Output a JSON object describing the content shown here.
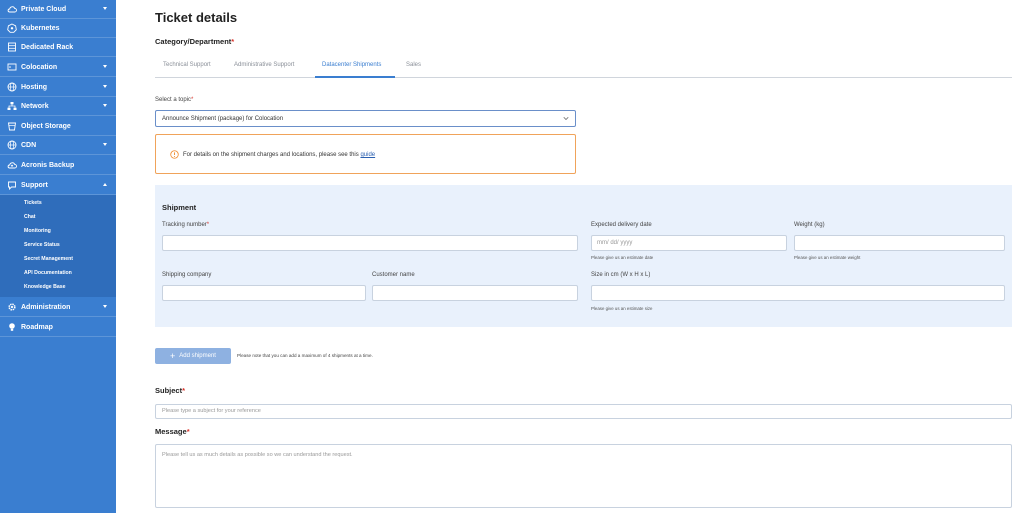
{
  "sidebar": {
    "items": [
      {
        "label": "Private Cloud",
        "icon": "cloud-icon",
        "chevron": "down"
      },
      {
        "label": "Kubernetes",
        "icon": "kubernetes-icon",
        "chevron": ""
      },
      {
        "label": "Dedicated Rack",
        "icon": "server-icon",
        "chevron": ""
      },
      {
        "label": "Colocation",
        "icon": "rack-icon",
        "chevron": "down"
      },
      {
        "label": "Hosting",
        "icon": "globe-icon",
        "chevron": "down"
      },
      {
        "label": "Network",
        "icon": "network-icon",
        "chevron": "down"
      },
      {
        "label": "Object Storage",
        "icon": "bucket-icon",
        "chevron": ""
      },
      {
        "label": "CDN",
        "icon": "globe-icon",
        "chevron": "down"
      },
      {
        "label": "Acronis Backup",
        "icon": "cloud-backup-icon",
        "chevron": ""
      },
      {
        "label": "Support",
        "icon": "support-icon",
        "chevron": "up"
      },
      {
        "label": "Administration",
        "icon": "gear-icon",
        "chevron": "down"
      },
      {
        "label": "Roadmap",
        "icon": "lightbulb-icon",
        "chevron": ""
      }
    ],
    "support_sub": [
      "Tickets",
      "Chat",
      "Monitoring",
      "Service Status",
      "Secret Management",
      "API Documentation",
      "Knowledge Base"
    ]
  },
  "page": {
    "title": "Ticket details",
    "category_label": "Category/Department",
    "tabs": [
      "Technical Support",
      "Administrative Support",
      "Datacenter Shipments",
      "Sales"
    ],
    "active_tab": "Datacenter Shipments",
    "topic_label": "Select a topic",
    "topic_value": "Announce Shipment (package) for Colocation",
    "notice_text": "For details on the shipment charges and locations, please see this ",
    "notice_link": "guide"
  },
  "shipment": {
    "title": "Shipment",
    "tracking_label": "Tracking number",
    "delivery_label": "Expected delivery date",
    "delivery_placeholder": "mm/ dd/ yyyy",
    "delivery_hint": "Please give us an estimate date",
    "weight_label": "Weight (kg)",
    "weight_hint": "Please give us an estimate weight",
    "company_label": "Shipping company",
    "customer_label": "Customer name",
    "size_label": "Size in cm (W x H x L)",
    "size_hint": "Please give us an estimate size"
  },
  "actions": {
    "add_label": "Add shipment",
    "add_note": "Please note that you can add a maximum of 4 shipments at a time."
  },
  "subject": {
    "label": "Subject",
    "placeholder": "Please type a subject for your reference"
  },
  "message": {
    "label": "Message",
    "placeholder": "Please tell us as much details as possible so we can understand the request."
  },
  "colors": {
    "sidebar": "#3a7ed0",
    "accent": "#3a7ed0",
    "required": "#d9342b",
    "notice_border": "#f0a35a"
  }
}
